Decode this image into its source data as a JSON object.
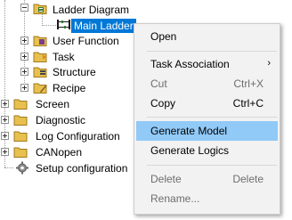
{
  "tree": {
    "items": [
      {
        "label": "Ladder Diagram",
        "icon": "ladder-folder-icon"
      },
      {
        "label": "Main Ladder",
        "icon": "ladder-program-icon",
        "selected": true
      },
      {
        "label": "User Function",
        "icon": "function-folder-icon"
      },
      {
        "label": "Task",
        "icon": "task-folder-icon"
      },
      {
        "label": "Structure",
        "icon": "structure-folder-icon"
      },
      {
        "label": "Recipe",
        "icon": "recipe-folder-icon"
      },
      {
        "label": "Screen",
        "icon": "folder-icon"
      },
      {
        "label": "Diagnostic",
        "icon": "folder-icon"
      },
      {
        "label": "Log Configuration",
        "icon": "folder-icon"
      },
      {
        "label": "CANopen",
        "icon": "folder-icon"
      },
      {
        "label": "Setup configuration",
        "icon": "setup-gear-icon"
      }
    ]
  },
  "context_menu": {
    "items": [
      {
        "label": "Open",
        "shortcut": "",
        "enabled": true
      },
      {
        "label": "Task Association",
        "shortcut": "",
        "enabled": true,
        "submenu": true
      },
      {
        "label": "Cut",
        "shortcut": "Ctrl+X",
        "enabled": false
      },
      {
        "label": "Copy",
        "shortcut": "Ctrl+C",
        "enabled": true
      },
      {
        "label": "Generate Model",
        "shortcut": "",
        "enabled": true,
        "highlighted": true
      },
      {
        "label": "Generate Logics",
        "shortcut": "",
        "enabled": true
      },
      {
        "label": "Delete",
        "shortcut": "Delete",
        "enabled": false
      },
      {
        "label": "Rename...",
        "shortcut": "",
        "enabled": false
      }
    ],
    "submenu_arrow": "›"
  },
  "colors": {
    "selection": "#0078d7",
    "menu_highlight": "#91c9f7",
    "menu_background": "#f2f2f2",
    "disabled_text": "#6d6d6d",
    "folder_yellow": "#e8c04e"
  }
}
